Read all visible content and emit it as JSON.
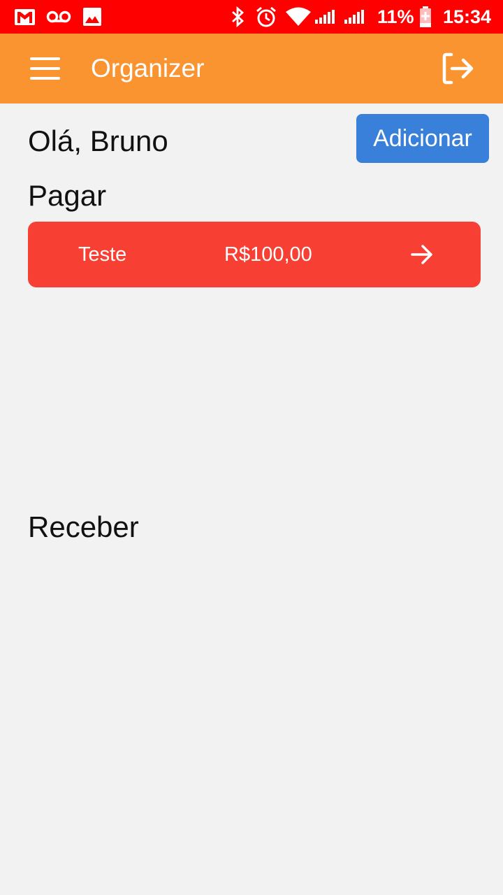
{
  "status_bar": {
    "battery": "11%",
    "time": "15:34",
    "icons": [
      "gmail-icon",
      "voicemail-icon",
      "image-icon",
      "bluetooth-icon",
      "alarm-icon",
      "wifi-icon",
      "signal-icon",
      "signal-icon-2",
      "battery-charging-icon"
    ]
  },
  "app_bar": {
    "title": "Organizer",
    "menu_icon": "hamburger-menu-icon",
    "logout_icon": "logout-icon"
  },
  "main": {
    "greeting": "Olá, Bruno",
    "add_button_label": "Adicionar",
    "pay_section": {
      "title": "Pagar",
      "items": [
        {
          "name": "Teste",
          "amount": "R$100,00",
          "icon": "arrow-right-icon"
        }
      ]
    },
    "receive_section": {
      "title": "Receber",
      "items": []
    }
  },
  "colors": {
    "status_bar": "#ff0000",
    "app_bar": "#fa9431",
    "background": "#f2f2f2",
    "add_button": "#3880d9",
    "pay_card": "#f83f33"
  }
}
